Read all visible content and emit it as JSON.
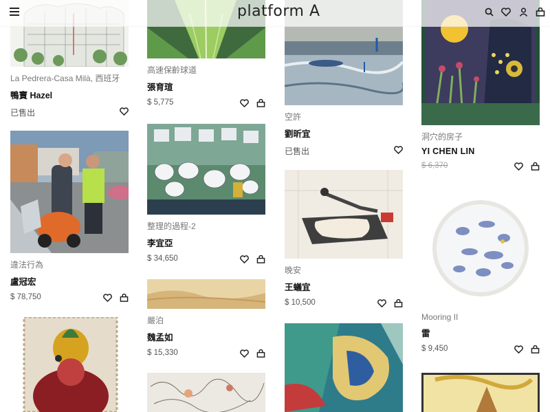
{
  "header": {
    "brand": "platform A",
    "icons": [
      "menu-icon",
      "search-icon",
      "heart-icon",
      "user-icon",
      "bag-icon"
    ]
  },
  "artworks": {
    "c1": [
      {
        "title": "La Pedrera-Casa Milà, 西班牙",
        "artist": "鴨寶 Hazel",
        "sold": "已售出"
      },
      {
        "title": "違法行為",
        "artist": "盧冠宏",
        "price": "$ 78,750"
      },
      {
        "title": "",
        "artist": ""
      }
    ],
    "c2": [
      {
        "title": "高速保齡球道",
        "artist": "張育瑄",
        "price": "$ 5,775"
      },
      {
        "title": "整理的過程-2",
        "artist": "李宜亞",
        "price": "$ 34,650"
      },
      {
        "title": "嚴泊",
        "artist": "魏孟如",
        "price": "$ 15,330"
      },
      {
        "title": "",
        "artist": ""
      }
    ],
    "c3": [
      {
        "title": "空許",
        "artist": "劉昕宜",
        "sold": "已售出"
      },
      {
        "title": "晚安",
        "artist": "王蟻宜",
        "price": "$ 10,500"
      },
      {
        "title": "",
        "artist": ""
      }
    ],
    "c4": [
      {
        "title": "洞穴的房子",
        "artist": "YI CHEN LIN",
        "price": "$ 6,370"
      },
      {
        "title": "Mooring II",
        "artist": "雷",
        "price": "$ 9,450"
      },
      {
        "title": "",
        "artist": ""
      }
    ]
  },
  "colors": {
    "accent": "#222222",
    "sold_text": "#555555",
    "strike": "#55aa99"
  }
}
